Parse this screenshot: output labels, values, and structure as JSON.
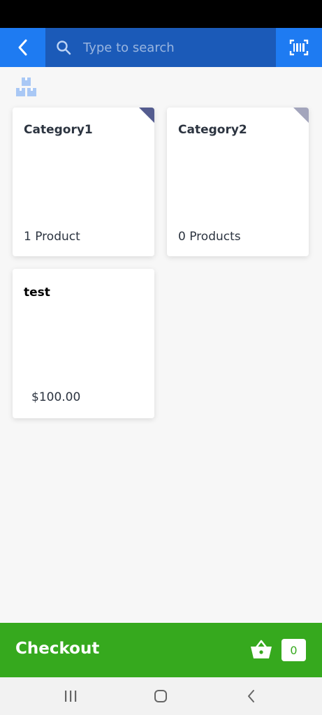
{
  "search": {
    "placeholder": "Type to search"
  },
  "categories": [
    {
      "name": "Category1",
      "count_label": "1 Product",
      "corner_color": "#545c8f"
    },
    {
      "name": "Category2",
      "count_label": "0 Products",
      "corner_color": "#a3a5bc"
    }
  ],
  "products": [
    {
      "name": "test",
      "price": "$100.00"
    }
  ],
  "checkout": {
    "label": "Checkout",
    "count": "0"
  },
  "colors": {
    "topbar": "#1e7bf2",
    "search_bg": "#1b5ab8",
    "checkout": "#36a91e",
    "icon_light": "#a9c8f5"
  },
  "icons": {
    "back": "chevron-left-icon",
    "search": "search-icon",
    "scan": "barcode-scan-icon",
    "categories": "boxes-icon",
    "basket": "basket-icon",
    "nav_recents": "recents-icon",
    "nav_home": "home-icon",
    "nav_back": "back-icon"
  }
}
